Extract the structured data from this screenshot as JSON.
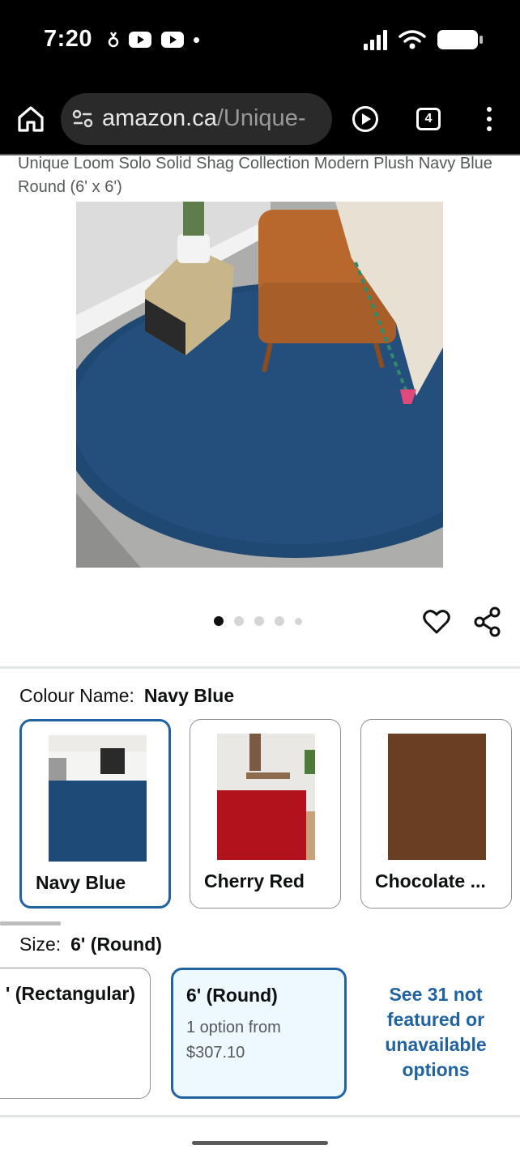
{
  "status_bar": {
    "time": "7:20",
    "icons_left": [
      "notification-icon",
      "youtube-icon",
      "youtube-icon",
      "dot-icon"
    ],
    "icons_right": [
      "signal-icon",
      "wifi-icon",
      "battery-icon"
    ]
  },
  "browser": {
    "url_host": "amazon.ca",
    "url_path": "/Unique-",
    "tab_count": "4",
    "icons": [
      "home-icon",
      "site-settings-icon",
      "play-icon",
      "tabs-icon",
      "more-icon"
    ]
  },
  "product": {
    "title": "Unique Loom Solo Solid Shag Collection Modern Plush Navy Blue Round (6' x 6')",
    "image_count": 5,
    "active_image": 1
  },
  "colour": {
    "label": "Colour Name:",
    "selected": "Navy Blue",
    "options": [
      {
        "name": "Navy Blue",
        "selected": true,
        "color": "#1e4a78"
      },
      {
        "name": "Cherry Red",
        "selected": false,
        "color": "#b2121b"
      },
      {
        "name": "Chocolate ...",
        "selected": false,
        "color": "#6a3e23"
      }
    ]
  },
  "size": {
    "label": "Size:",
    "selected": "6' (Round)",
    "options": [
      {
        "title": "' (Rectangular)",
        "selected": false
      },
      {
        "title": "6' (Round)",
        "selected": true,
        "subtitle": "1 option from",
        "price": "$307.10"
      }
    ],
    "see_more": "See 31 not featured or unavailable options"
  },
  "colors": {
    "link": "#2162a1",
    "selected_border": "#2162a1",
    "selected_bg": "#edf8ff",
    "secondary_text": "#565959"
  }
}
